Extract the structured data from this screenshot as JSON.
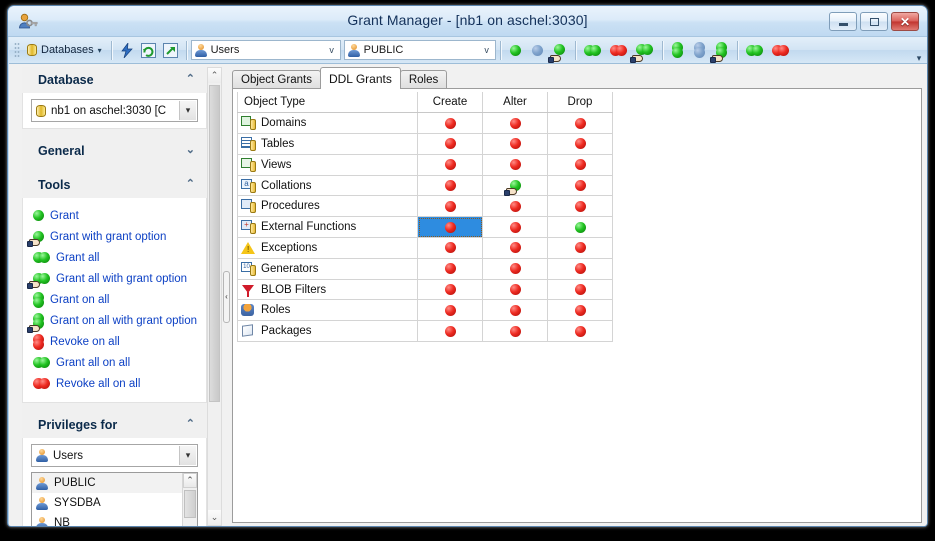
{
  "window": {
    "title": "Grant Manager - [nb1 on aschel:3030]",
    "app_icon": "user-key-icon",
    "buttons": {
      "minimize": "minimize-icon",
      "maximize": "maximize-icon",
      "close": "close-icon"
    }
  },
  "toolbar": {
    "databases_label": "Databases",
    "databases_dropdown_arrow": "▾",
    "icon_buttons": [
      "lightning-icon",
      "refresh-icon",
      "export-icon"
    ],
    "user_combo": {
      "value": "Users",
      "icon": "user-icon",
      "arrow": "v"
    },
    "grantee_combo": {
      "value": "PUBLIC",
      "icon": "user-icon",
      "arrow": "v"
    },
    "action_icons": [
      {
        "name": "grant-icon",
        "kind": "dot-green"
      },
      {
        "name": "revoke-blue-icon",
        "kind": "dot-blue"
      },
      {
        "name": "grant-with-grant-option-icon",
        "kind": "dot-green-hand"
      },
      {
        "name": "grant-all-icon",
        "kind": "twodot-green"
      },
      {
        "name": "revoke-all-icon",
        "kind": "twodot-red"
      },
      {
        "name": "grant-all-with-grant-option-icon",
        "kind": "twodot-green-hand"
      },
      {
        "name": "grant-on-all-icon",
        "kind": "vdot-green"
      },
      {
        "name": "revoke-on-all-blue-icon",
        "kind": "vdot-blue"
      },
      {
        "name": "grant-on-all-with-grant-option-icon",
        "kind": "vdot-green-hand"
      },
      {
        "name": "grant-all-on-all-icon",
        "kind": "twodot-green"
      },
      {
        "name": "revoke-all-on-all-icon",
        "kind": "twodot-red"
      }
    ],
    "overflow": "chevron-down-icon"
  },
  "sidebar": {
    "sections": [
      {
        "title": "Database",
        "collapse_icon": "chevron-up-icon",
        "database_combo": {
          "value": "nb1 on aschel:3030 [C",
          "icon": "database-icon"
        }
      },
      {
        "title": "General",
        "collapse_icon": "chevron-down-icon"
      },
      {
        "title": "Tools",
        "collapse_icon": "chevron-up-icon",
        "items": [
          {
            "label": "Grant",
            "icon": "dot-green"
          },
          {
            "label": "Grant with grant option",
            "icon": "dot-green-hand"
          },
          {
            "label": "Grant all",
            "icon": "twodot-green"
          },
          {
            "label": "Grant all with grant option",
            "icon": "twodot-green-hand"
          },
          {
            "label": "Grant on all",
            "icon": "vdot-green"
          },
          {
            "label": "Grant on all with grant option",
            "icon": "vdot-green-hand"
          },
          {
            "label": "Revoke on all",
            "icon": "vdot-red"
          },
          {
            "label": "Grant all on all",
            "icon": "twodot-green"
          },
          {
            "label": "Revoke all on all",
            "icon": "twodot-red"
          }
        ]
      },
      {
        "title": "Privileges for",
        "collapse_icon": "chevron-up-icon",
        "type_combo": {
          "value": "Users",
          "icon": "user-icon"
        },
        "list": [
          {
            "label": "PUBLIC",
            "selected": true
          },
          {
            "label": "SYSDBA",
            "selected": false
          },
          {
            "label": "NB",
            "selected": false
          }
        ]
      }
    ]
  },
  "tabs": [
    {
      "label": "Object Grants",
      "active": false
    },
    {
      "label": "DDL Grants",
      "active": true
    },
    {
      "label": "Roles",
      "active": false
    }
  ],
  "grid": {
    "columns": [
      "Object Type",
      "Create",
      "Alter",
      "Drop"
    ],
    "rows": [
      {
        "icon": "domain-icon",
        "name": "Domains",
        "create": "red",
        "alter": "red",
        "drop": "red"
      },
      {
        "icon": "table-icon",
        "name": "Tables",
        "create": "red",
        "alter": "red",
        "drop": "red"
      },
      {
        "icon": "view-icon",
        "name": "Views",
        "create": "red",
        "alter": "red",
        "drop": "red"
      },
      {
        "icon": "collation-icon",
        "name": "Collations",
        "create": "red",
        "alter": "green-hand",
        "drop": "red"
      },
      {
        "icon": "procedure-icon",
        "name": "Procedures",
        "create": "red",
        "alter": "red",
        "drop": "red"
      },
      {
        "icon": "external-function-icon",
        "name": "External Functions",
        "create": "red",
        "alter": "red",
        "drop": "green",
        "selected_cell": "create"
      },
      {
        "icon": "exception-icon",
        "name": "Exceptions",
        "create": "red",
        "alter": "red",
        "drop": "red"
      },
      {
        "icon": "generator-icon",
        "name": "Generators",
        "create": "red",
        "alter": "red",
        "drop": "red"
      },
      {
        "icon": "blob-filter-icon",
        "name": "BLOB Filters",
        "create": "red",
        "alter": "red",
        "drop": "red"
      },
      {
        "icon": "role-icon",
        "name": "Roles",
        "create": "red",
        "alter": "red",
        "drop": "red"
      },
      {
        "icon": "package-icon",
        "name": "Packages",
        "create": "red",
        "alter": "red",
        "drop": "red"
      }
    ]
  },
  "colors": {
    "selection_blue": "#2e8ce0",
    "granted_green": "#22c322",
    "revoked_red": "#ee2b22",
    "link_blue": "#0b3fc4",
    "title_text": "#13315a"
  }
}
